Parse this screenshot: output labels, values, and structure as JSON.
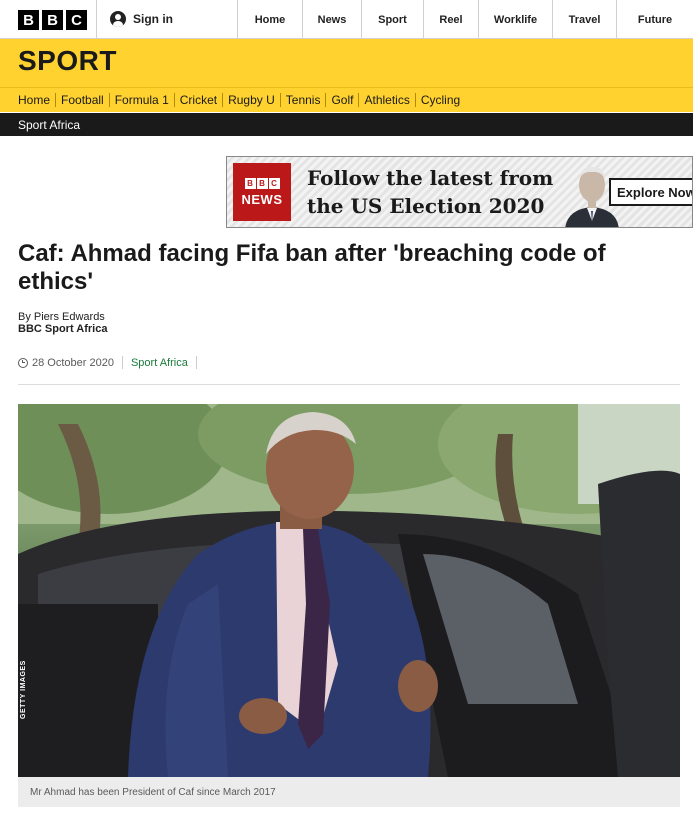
{
  "brand": {
    "letters": [
      "B",
      "B",
      "C"
    ]
  },
  "topbar": {
    "signin_label": "Sign in",
    "nav": [
      "Home",
      "News",
      "Sport",
      "Reel",
      "Worklife",
      "Travel",
      "Future"
    ]
  },
  "sport": {
    "title": "SPORT",
    "subnav": [
      "Home",
      "Football",
      "Formula 1",
      "Cricket",
      "Rugby U",
      "Tennis",
      "Golf",
      "Athletics",
      "Cycling"
    ],
    "section": "Sport Africa"
  },
  "ad": {
    "logo_letters": [
      "B",
      "B",
      "C"
    ],
    "logo_word": "NEWS",
    "line1": "Follow the latest from",
    "line2": "the US Election 2020",
    "cta": "Explore Now"
  },
  "article": {
    "headline": "Caf: Ahmad facing Fifa ban after 'breaching code of ethics'",
    "author": "By Piers Edwards",
    "author_org": "BBC Sport Africa",
    "date": "28 October 2020",
    "section_link": "Sport Africa",
    "image_credit": "GETTY IMAGES",
    "caption": "Mr Ahmad has been President of Caf since March 2017"
  },
  "colors": {
    "sport_yellow": "#ffd230",
    "section_bar": "#1a1a1a",
    "link_green": "#1a7a3a",
    "bbc_red": "#bb1919"
  }
}
